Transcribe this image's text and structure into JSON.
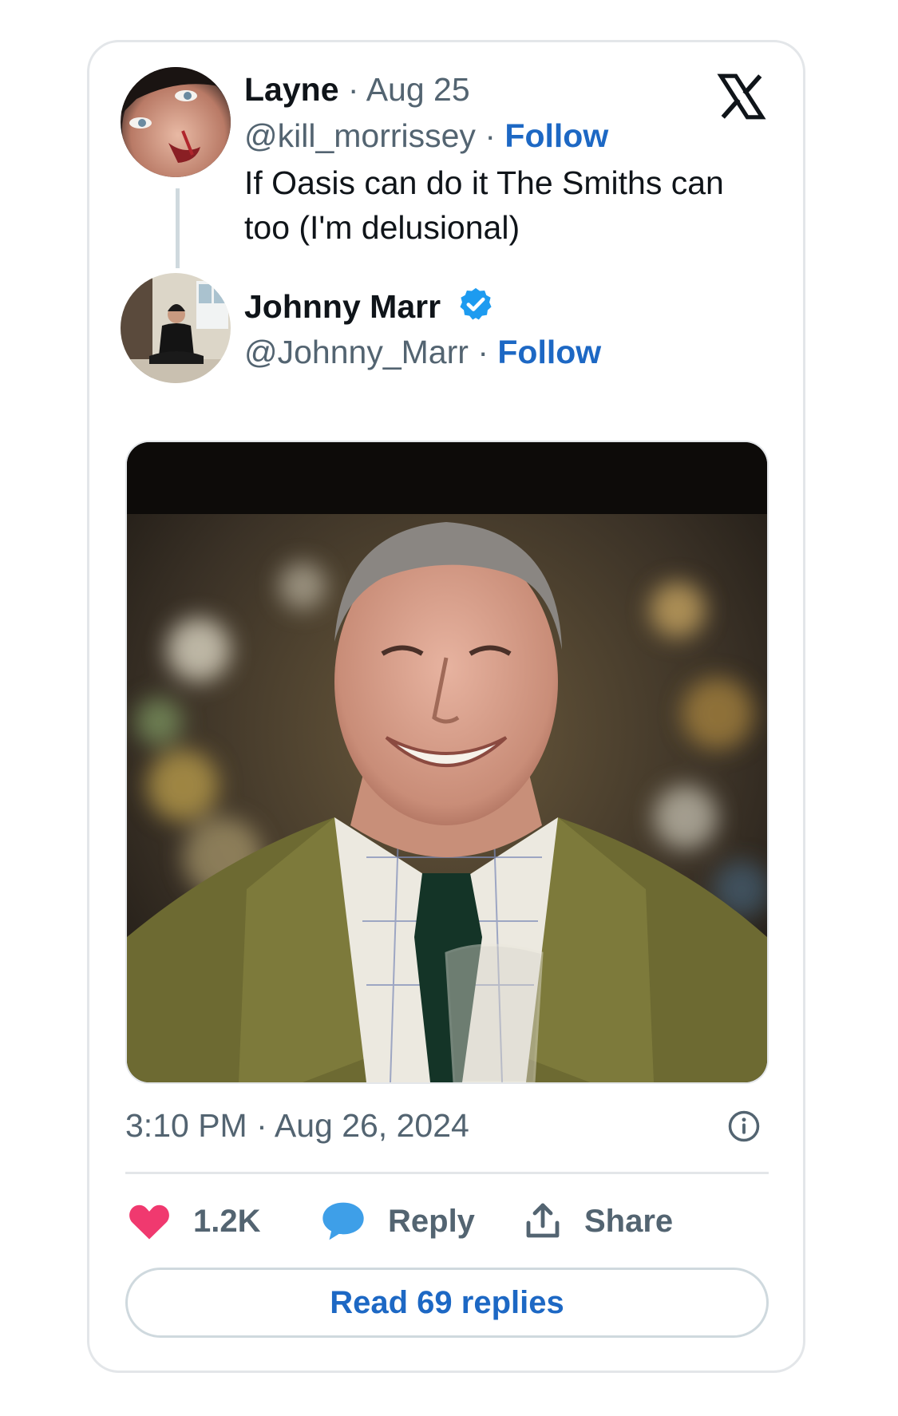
{
  "reply_to": {
    "name": "Layne",
    "date": "Aug 25",
    "handle": "@kill_morrissey",
    "follow_label": "Follow",
    "text_line1": "If Oasis can do it The Smiths can",
    "text_line2": "too (I'm delusional)"
  },
  "tweet": {
    "name": "Johnny Marr",
    "handle": "@Johnny_Marr",
    "follow_label": "Follow",
    "verified": true,
    "timestamp": "3:10 PM · Aug 26, 2024"
  },
  "separator": "·",
  "actions": {
    "likes": "1.2K",
    "reply_label": "Reply",
    "share_label": "Share",
    "read_replies_label": "Read 69 replies"
  },
  "icons": {
    "brand": "x-logo-icon",
    "verified": "verified-badge-icon",
    "info": "info-icon",
    "like": "heart-icon",
    "reply": "speech-bubble-icon",
    "share": "share-upload-icon"
  },
  "colors": {
    "link_blue": "#1d68c4",
    "verified_blue": "#1d9bf0",
    "heart_pink": "#f0396f",
    "reply_blue": "#3e9fe8",
    "muted_text": "#536471"
  }
}
